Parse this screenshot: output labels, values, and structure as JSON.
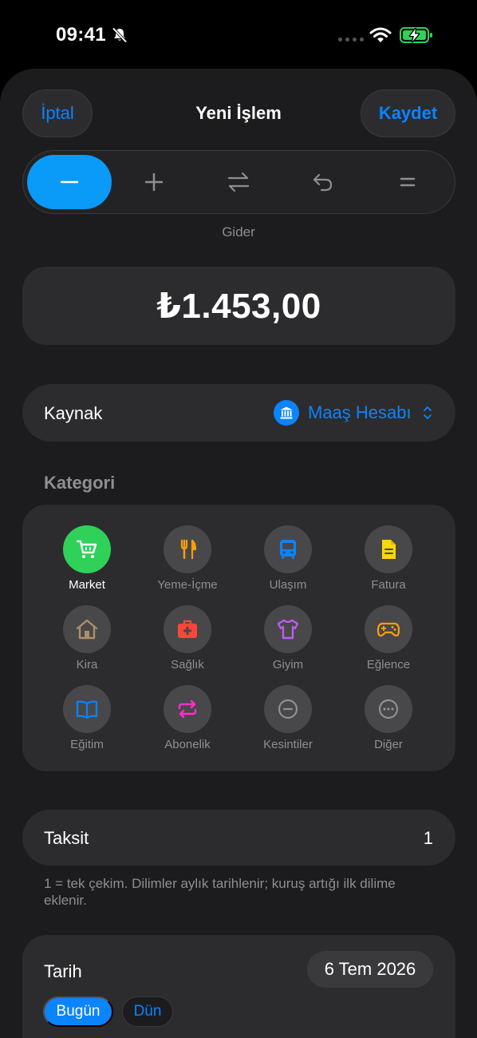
{
  "status_bar": {
    "time": "09:41"
  },
  "nav": {
    "cancel": "İptal",
    "title": "Yeni İşlem",
    "save": "Kaydet"
  },
  "type_segment": {
    "items": [
      {
        "icon": "minus-icon",
        "active": true
      },
      {
        "icon": "plus-icon",
        "active": false
      },
      {
        "icon": "transfer-arrows-icon",
        "active": false
      },
      {
        "icon": "undo-arrow-icon",
        "active": false
      },
      {
        "icon": "equals-icon",
        "active": false
      }
    ],
    "selected_caption": "Gider"
  },
  "amount": {
    "value": "₺1.453,00"
  },
  "source": {
    "label": "Kaynak",
    "value": "Maaş Hesabı",
    "icon": "bank-icon"
  },
  "category": {
    "title": "Kategori",
    "items": [
      {
        "label": "Market",
        "icon": "cart-icon",
        "color": "#ffffff",
        "selected": true
      },
      {
        "label": "Yeme-İçme",
        "icon": "fork-knife-icon",
        "color": "#ff9f0a",
        "selected": false
      },
      {
        "label": "Ulaşım",
        "icon": "bus-icon",
        "color": "#0a84ff",
        "selected": false
      },
      {
        "label": "Fatura",
        "icon": "document-icon",
        "color": "#ffd60a",
        "selected": false
      },
      {
        "label": "Kira",
        "icon": "house-icon",
        "color": "#ac8e68",
        "selected": false
      },
      {
        "label": "Sağlık",
        "icon": "medkit-icon",
        "color": "#ff453a",
        "selected": false
      },
      {
        "label": "Giyim",
        "icon": "tshirt-icon",
        "color": "#bf5af2",
        "selected": false
      },
      {
        "label": "Eğlence",
        "icon": "gamepad-icon",
        "color": "#ff9f0a",
        "selected": false
      },
      {
        "label": "Eğitim",
        "icon": "book-icon",
        "color": "#0a84ff",
        "selected": false
      },
      {
        "label": "Abonelik",
        "icon": "repeat-icon",
        "color": "#ff2dcf",
        "selected": false
      },
      {
        "label": "Kesintiler",
        "icon": "minus-circle-icon",
        "color": "#8e8e93",
        "selected": false
      },
      {
        "label": "Diğer",
        "icon": "ellipsis-circle-icon",
        "color": "#8e8e93",
        "selected": false
      }
    ]
  },
  "installment": {
    "label": "Taksit",
    "value": "1",
    "note": "1 = tek çekim. Dilimler aylık tarihlenir; kuruş artığı ilk dilime eklenir."
  },
  "date": {
    "label": "Tarih",
    "value": "6 Tem 2026",
    "today": "Bugün",
    "yesterday": "Dün"
  },
  "colors": {
    "accent": "#0a84ff",
    "segment_active": "#0a9af7",
    "selected_category": "#30d158",
    "card": "#2c2c2e",
    "sheet": "#1c1c1e"
  }
}
